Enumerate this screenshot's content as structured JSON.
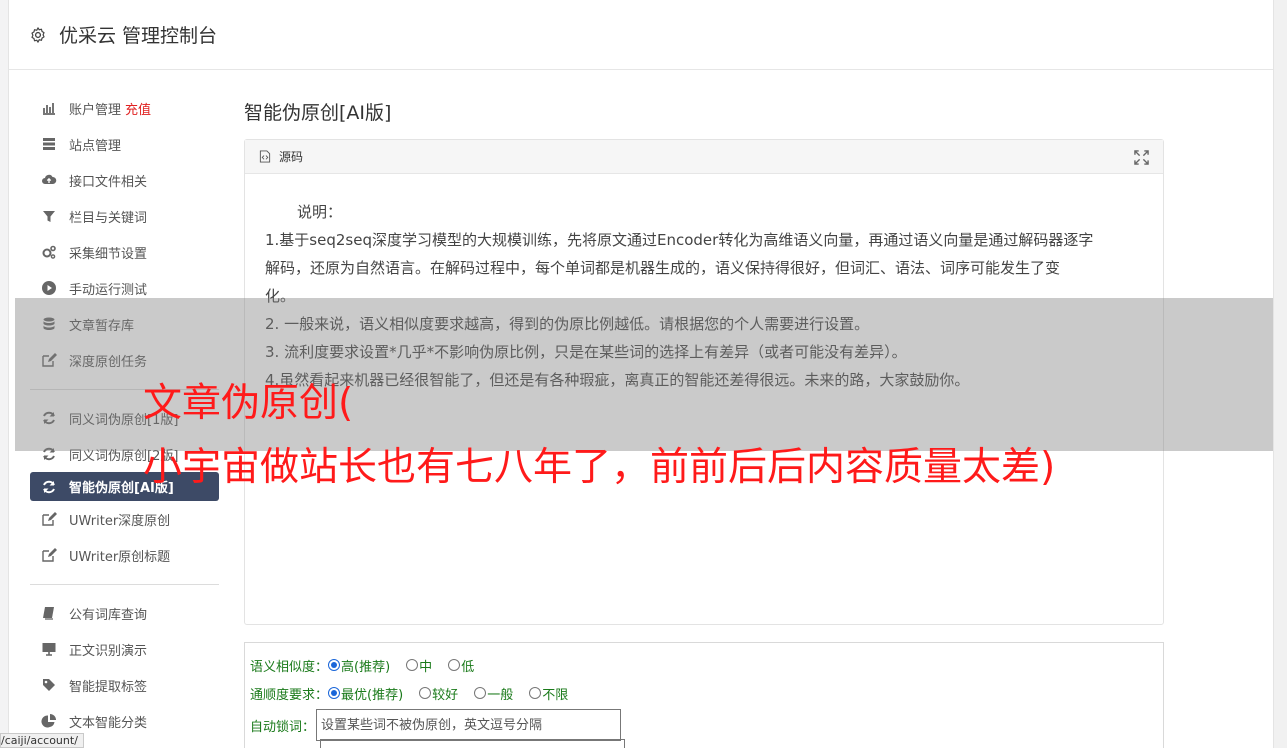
{
  "header": {
    "title": "优采云 管理控制台"
  },
  "sidebar": {
    "group1": [
      {
        "label": "账户管理",
        "badge": "充值",
        "icon": "bar-chart-icon"
      },
      {
        "label": "站点管理",
        "icon": "server-icon"
      },
      {
        "label": "接口文件相关",
        "icon": "cloud-upload-icon"
      },
      {
        "label": "栏目与关键词",
        "icon": "filter-icon"
      },
      {
        "label": "采集细节设置",
        "icon": "gears-icon"
      },
      {
        "label": "手动运行测试",
        "icon": "play-icon"
      },
      {
        "label": "文章暂存库",
        "icon": "database-icon"
      },
      {
        "label": "深度原创任务",
        "icon": "edit-icon"
      }
    ],
    "group2": [
      {
        "label": "同义词伪原创[1版]",
        "icon": "refresh-icon"
      },
      {
        "label": "同义词伪原创[2版]",
        "icon": "refresh-icon"
      },
      {
        "label": "智能伪原创[AI版]",
        "icon": "refresh-icon",
        "active": true
      },
      {
        "label": "UWriter深度原创",
        "icon": "edit-icon"
      },
      {
        "label": "UWriter原创标题",
        "icon": "edit-icon"
      }
    ],
    "group3": [
      {
        "label": "公有词库查询",
        "icon": "book-icon"
      },
      {
        "label": "正文识别演示",
        "icon": "monitor-icon"
      },
      {
        "label": "智能提取标签",
        "icon": "tag-icon"
      },
      {
        "label": "文本智能分类",
        "icon": "pie-chart-icon"
      }
    ]
  },
  "main": {
    "title": "智能伪原创[AI版]",
    "panel": {
      "tab_label": "源码",
      "heading": "说明：",
      "lines": [
        "1.基于seq2seq深度学习模型的大规模训练，先将原文通过Encoder转化为高维语义向量，再通过语义向量是通过解码器逐字",
        "解码，还原为自然语言。在解码过程中，每个单词都是机器生成的，语义保持得很好，但词汇、语法、词序可能发生了变",
        "化。",
        "2. 一般来说，语义相似度要求越高，得到的伪原比例越低。请根据您的个人需要进行设置。",
        "3. 流利度要求设置*几乎*不影响伪原比例，只是在某些词的选择上有差异（或者可能没有差异）。",
        "4.虽然看起来机器已经很智能了，但还是有各种瑕疵，离真正的智能还差得很远。未来的路，大家鼓励你。"
      ]
    },
    "options": {
      "similarity_label": "语义相似度：",
      "similarity": [
        "高(推荐)",
        "中",
        "低"
      ],
      "fluency_label": "通顺度要求：",
      "fluency": [
        "最优(推荐)",
        "较好",
        "一般",
        "不限"
      ],
      "lock_label": "自动锁词：",
      "lock_placeholder": "设置某些词不被伪原创，英文逗号分隔"
    }
  },
  "overlay": {
    "line1": "文章伪原创(",
    "line2": "小宇宙做站长也有七八年了，前前后后内容质量太差)"
  },
  "status_url": "/caiji/account/",
  "colors": {
    "active_nav": "#3d4a66",
    "badge": "#e02020",
    "option_text": "#1a7a1a",
    "overlay_text": "#ff1a1a"
  }
}
